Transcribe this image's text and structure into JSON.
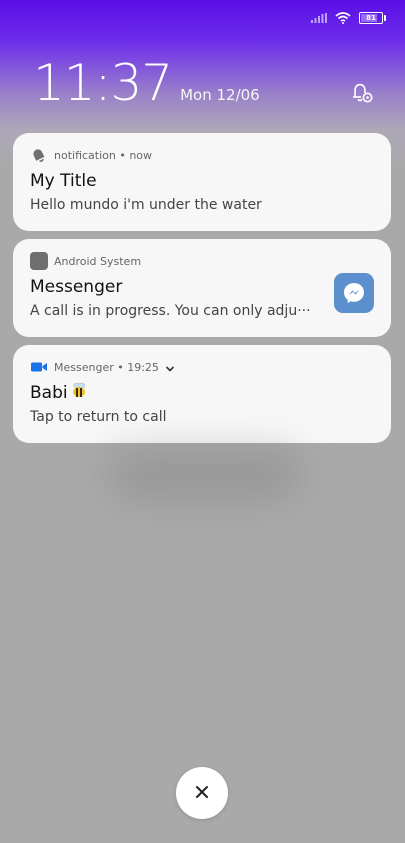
{
  "status_bar": {
    "battery_text": "81"
  },
  "lockscreen": {
    "time": "11:37",
    "date": "Mon 12/06"
  },
  "notifications": [
    {
      "app_icon": "bell-icon",
      "header": "notification • now",
      "title": "My Title",
      "body": "Hello mundo i'm under the water"
    },
    {
      "app_icon": "android-system-icon",
      "header": "Android System",
      "title": "Messenger",
      "body": "A call is in progress. You can only adju···",
      "large_icon": "messenger-icon"
    },
    {
      "app_icon": "video-camera-icon",
      "header": "Messenger • 19:25",
      "title": "Babi",
      "title_emoji": "bee-icon",
      "body": "Tap to return to call"
    }
  ],
  "colors": {
    "top_gradient": "#5a0fe6",
    "background": "#a9a9a9",
    "card": "#f7f7f7",
    "messenger_blue": "#5b8fce",
    "video_blue": "#1a73e8"
  },
  "clear_button": {
    "icon": "close-icon"
  }
}
